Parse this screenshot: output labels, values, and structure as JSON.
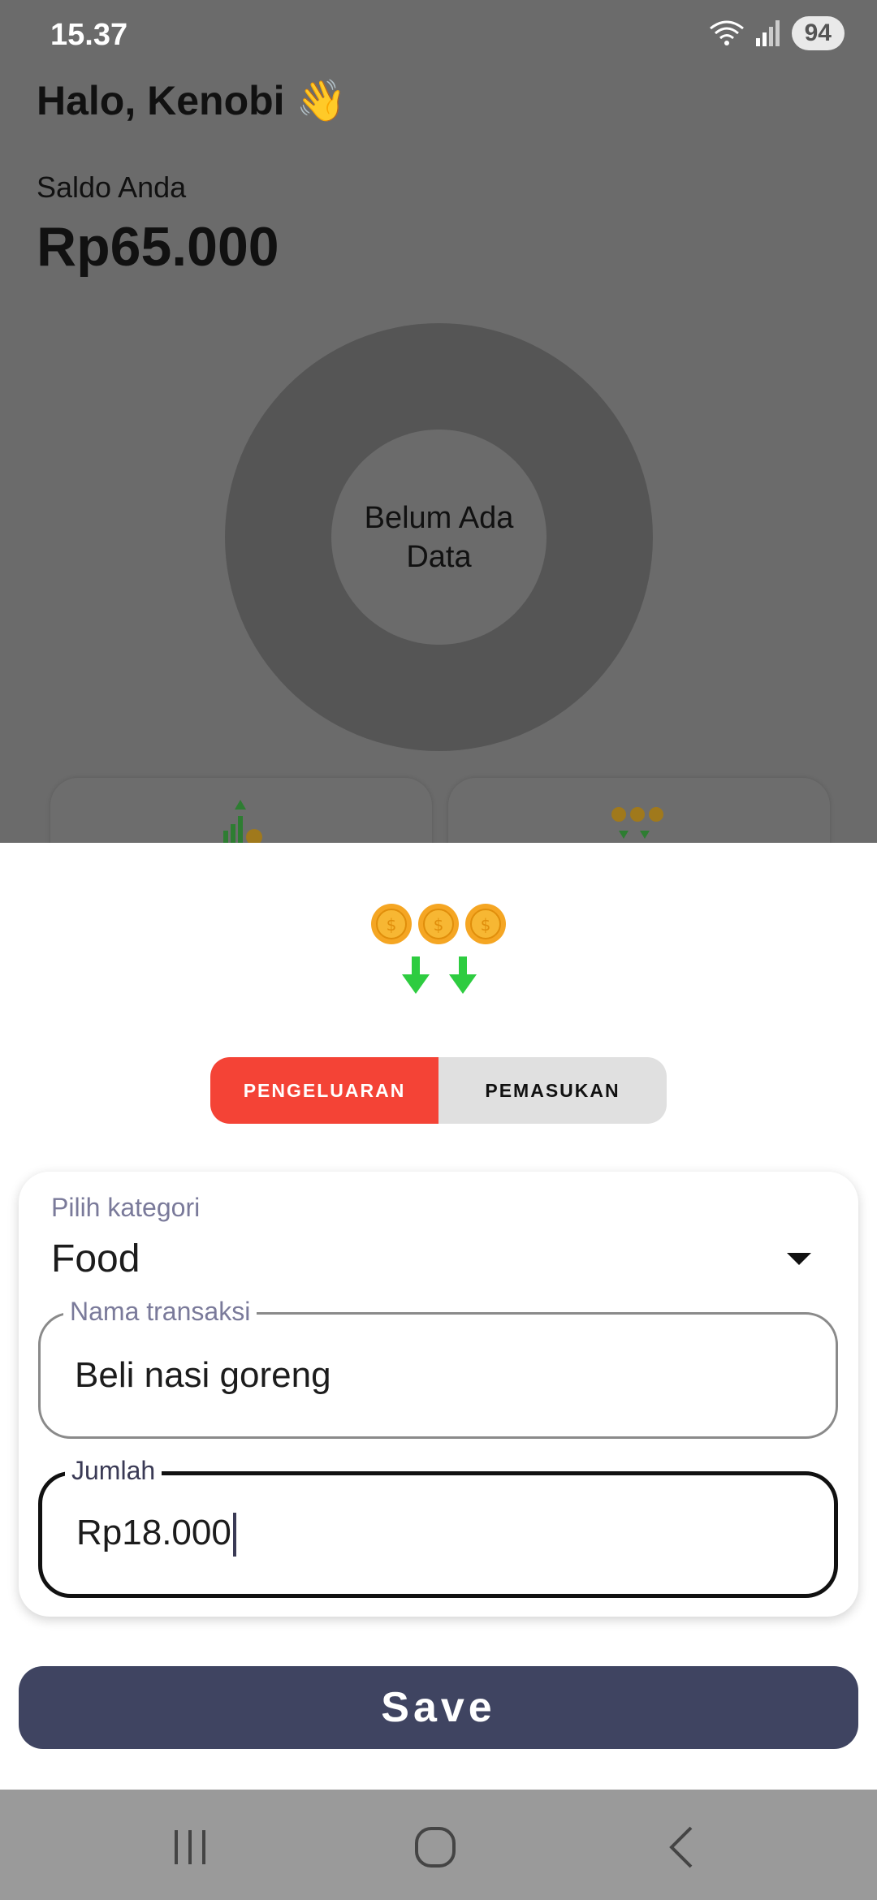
{
  "status_bar": {
    "time": "15.37",
    "battery": "94"
  },
  "background": {
    "greeting": "Halo, Kenobi 👋",
    "balance_label": "Saldo Anda",
    "balance_value": "Rp65.000",
    "chart_empty_text": "Belum Ada Data"
  },
  "sheet": {
    "hero_icon": "coins-down-icon",
    "tabs": [
      {
        "label": "PENGELUARAN",
        "active": true
      },
      {
        "label": "PEMASUKAN",
        "active": false
      }
    ],
    "category": {
      "label": "Pilih kategori",
      "value": "Food"
    },
    "name_field": {
      "label": "Nama transaksi",
      "value": "Beli nasi goreng"
    },
    "amount_field": {
      "label": "Jumlah",
      "value": "Rp18.000"
    },
    "save_label": "Save"
  },
  "colors": {
    "expense_accent": "#f44336",
    "save_button": "#3f4461",
    "coin": "#f5a623",
    "arrow_green": "#2ecc40"
  },
  "nav": {
    "icons": [
      "recent-apps-icon",
      "home-icon",
      "back-icon"
    ]
  }
}
